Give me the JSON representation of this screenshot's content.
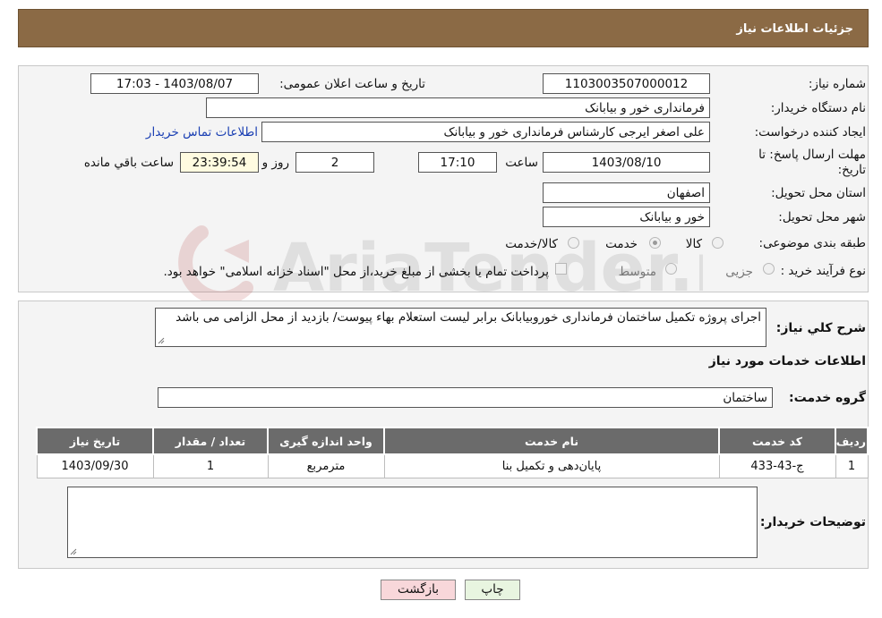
{
  "header": {
    "title": "جزئیات اطلاعات نیاز"
  },
  "form": {
    "need_number_label": "شماره نیاز:",
    "need_number": "1103003507000012",
    "announce_label": "تاریخ و ساعت اعلان عمومی:",
    "announce_value": "1403/08/07 - 17:03",
    "buyer_org_label": "نام دستگاه خریدار:",
    "buyer_org": "فرمانداری خور و بیابانک",
    "creator_label": "ایجاد کننده درخواست:",
    "creator": "علی اصغر ایرجی کارشناس فرمانداری خور و بیابانک",
    "contact_link": "اطلاعات تماس خریدار",
    "deadline_label": "مهلت ارسال پاسخ: تا",
    "deadline_label2": "تاریخ:",
    "deadline_date": "1403/08/10",
    "time_label": "ساعت",
    "deadline_time": "17:10",
    "days_value": "2",
    "days_label": "روز و",
    "remaining_value": "23:39:54",
    "remaining_label": "ساعت باقي مانده",
    "province_label": "استان محل تحویل:",
    "province": "اصفهان",
    "city_label": "شهر محل تحویل:",
    "city": "خور و بیابانک",
    "category_label": "طبقه بندی موضوعی:",
    "category_options": [
      "کالا",
      "خدمت",
      "کالا/خدمت"
    ],
    "category_selected": "خدمت",
    "process_label": "نوع فرآیند خرید :",
    "process_options": [
      "جزیی",
      "متوسط"
    ],
    "process_note": "پرداخت تمام یا بخشی از مبلغ خرید،از محل \"اسناد خزانه اسلامی\" خواهد بود."
  },
  "description": {
    "label": "شرح کلي نياز:",
    "text": "اجرای پروژه تکمیل ساختمان فرمانداری خوروبیابانک برابر لیست استعلام بهاء پیوست/ بازدید از محل الزامی می باشد"
  },
  "services": {
    "section_title": "اطلاعات خدمات مورد نياز",
    "group_label": "گروه خدمت:",
    "group_value": "ساختمان",
    "columns": [
      "رديف",
      "کد خدمت",
      "نام خدمت",
      "واحد اندازه گيری",
      "تعداد / مقدار",
      "تاريخ نياز"
    ],
    "rows": [
      [
        "1",
        "ج-43-433",
        "پایان‌دهی و تکمیل بنا",
        "مترمربع",
        "1",
        "1403/09/30"
      ]
    ]
  },
  "buyer_notes": {
    "label": "توضیحات خریدار:",
    "text": ""
  },
  "buttons": {
    "print": "چاپ",
    "back": "بازگشت"
  },
  "watermark": {
    "text": "AriaTender.neT"
  },
  "colors": {
    "header_bg": "#8b6a45",
    "table_header": "#6b6b6b",
    "back_button": "#f8d7da",
    "print_button": "#e8f5e0"
  }
}
